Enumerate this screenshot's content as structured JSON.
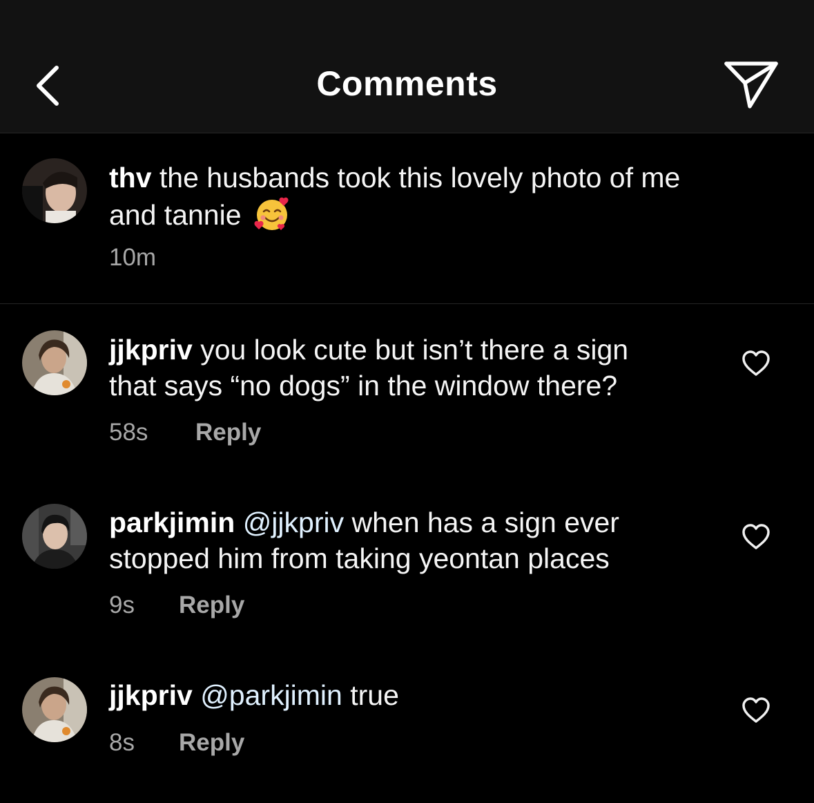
{
  "header": {
    "title": "Comments",
    "back_icon": "chevron-left-icon",
    "send_icon": "paper-plane-icon"
  },
  "caption": {
    "username": "thv",
    "text_line1": "the husbands took this lovely photo of me",
    "text_line2": "and tannie",
    "emoji": "smiling-face-with-hearts",
    "time": "10m"
  },
  "comments": [
    {
      "username": "jjkpriv",
      "mention": "",
      "line1": "you look cute but isn’t there a sign",
      "line2": "that says “no dogs” in the window there?",
      "time": "58s",
      "reply_label": "Reply"
    },
    {
      "username": "parkjimin",
      "mention": "@jjkpriv",
      "line1": "when has a sign ever",
      "line2": "stopped him from taking yeontan places",
      "time": "9s",
      "reply_label": "Reply"
    },
    {
      "username": "jjkpriv",
      "mention": "@parkjimin",
      "line1": "true",
      "line2": "",
      "time": "8s",
      "reply_label": "Reply"
    }
  ],
  "colors": {
    "background": "#000000",
    "header_bg": "#121212",
    "secondary_text": "#a8a8a8",
    "mention": "#e0f1ff"
  }
}
